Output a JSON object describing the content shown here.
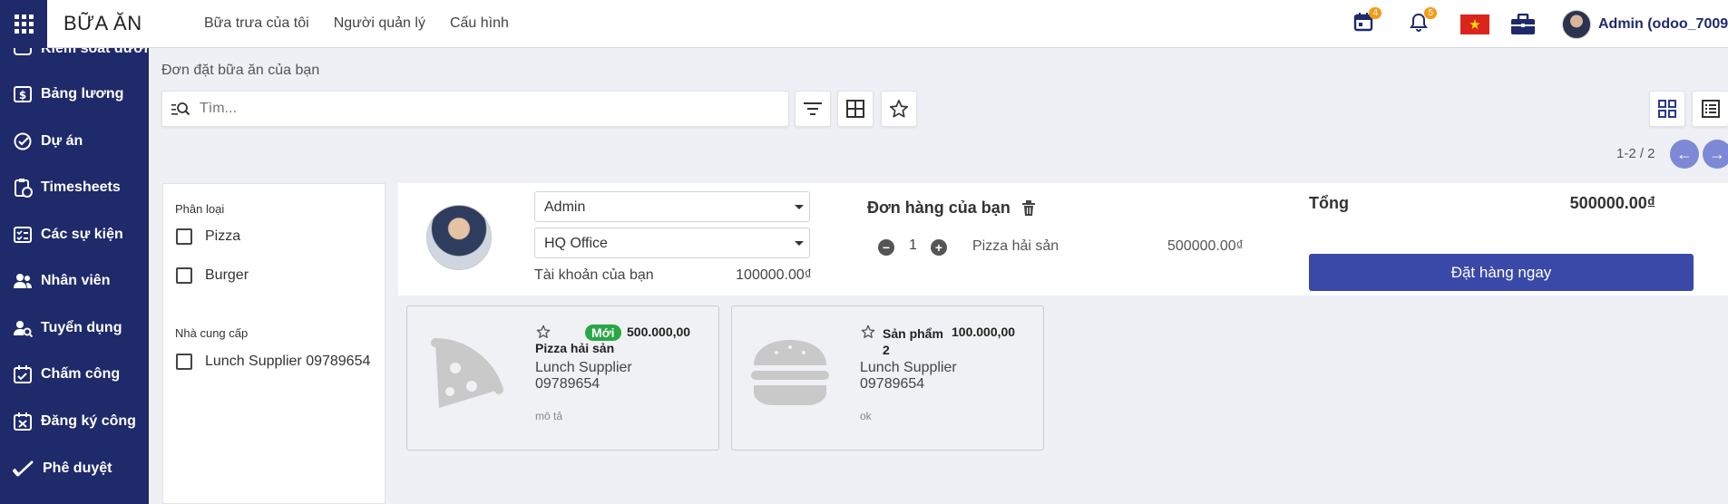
{
  "app": {
    "title": "BỮA ĂN"
  },
  "top_menu": [
    "Bữa trưa của tôi",
    "Người quản lý",
    "Cấu hình"
  ],
  "systray": {
    "calendar_count": "4",
    "notification_count": "5",
    "user_name": "Admin (odoo_7009)"
  },
  "sidebar": {
    "items": [
      {
        "label": "Kiểm soát dươn",
        "icon": "access-control-icon"
      },
      {
        "label": "Bảng lương",
        "icon": "payroll-icon"
      },
      {
        "label": "Dự án",
        "icon": "project-check-icon"
      },
      {
        "label": "Timesheets",
        "icon": "timesheet-clipboard-icon"
      },
      {
        "label": "Các sự kiện",
        "icon": "events-list-icon"
      },
      {
        "label": "Nhân viên",
        "icon": "employees-icon"
      },
      {
        "label": "Tuyển dụng",
        "icon": "recruitment-search-icon"
      },
      {
        "label": "Chấm công",
        "icon": "attendance-calendar-icon"
      },
      {
        "label": "Đăng ký công",
        "icon": "registration-calendar-icon"
      },
      {
        "label": "Phê duyệt",
        "icon": "approval-check-icon"
      }
    ]
  },
  "breadcrumb": "Đơn đặt bữa ăn của bạn",
  "search": {
    "placeholder": "Tìm..."
  },
  "pager": {
    "text": "1-2 / 2"
  },
  "filters": {
    "category_title": "Phân loại",
    "categories": [
      "Pizza",
      "Burger"
    ],
    "supplier_title": "Nhà cung cấp",
    "suppliers": [
      "Lunch Supplier 09789654"
    ]
  },
  "order": {
    "user": "Admin",
    "location": "HQ Office",
    "account_label": "Tài khoản của bạn",
    "account_balance": "100000.00₫",
    "title": "Đơn hàng của bạn",
    "line": {
      "qty": "1",
      "product": "Pizza hải sản",
      "amount": "500000.00₫"
    },
    "total_label": "Tổng",
    "total_value": "500000.00₫",
    "order_button": "Đặt hàng ngay"
  },
  "products": [
    {
      "name": "Pizza hải sản",
      "badge": "Mới",
      "price": "500.000,00",
      "supplier": "Lunch Supplier 09789654",
      "description": "mô tả",
      "image_icon": "pizza-icon"
    },
    {
      "name": "Sản phẩm 2",
      "price": "100.000,00",
      "supplier": "Lunch Supplier 09789654",
      "description": "ok",
      "image_icon": "burger-icon"
    }
  ],
  "colors": {
    "sidebar_bg": "#1f2a6b",
    "primary": "#3a49a8",
    "badge_new": "#28a745",
    "systray_badge": "#f39c12"
  }
}
